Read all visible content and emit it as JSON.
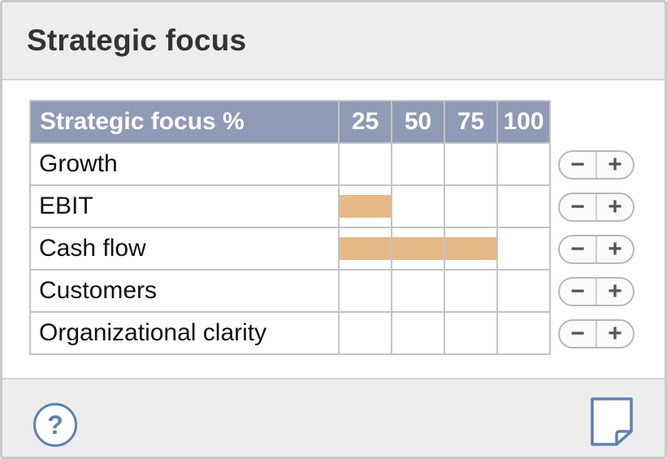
{
  "panel": {
    "title": "Strategic focus"
  },
  "grid": {
    "header_label": "Strategic focus %",
    "columns": [
      "25",
      "50",
      "75",
      "100"
    ],
    "rows": [
      {
        "label": "Growth",
        "percent": 0
      },
      {
        "label": "EBIT",
        "percent": 25
      },
      {
        "label": "Cash flow",
        "percent": 75
      },
      {
        "label": "Customers",
        "percent": 0
      },
      {
        "label": "Organizational clarity",
        "percent": 0
      }
    ]
  },
  "stepper": {
    "minus_label": "−",
    "plus_label": "+"
  },
  "footer": {
    "help_label": "?",
    "help_icon": "help-icon",
    "note_icon": "note-icon"
  },
  "colors": {
    "header_bg": "#8f9bb6",
    "bar_fill": "#e6b888",
    "accent": "#5b82b0"
  }
}
